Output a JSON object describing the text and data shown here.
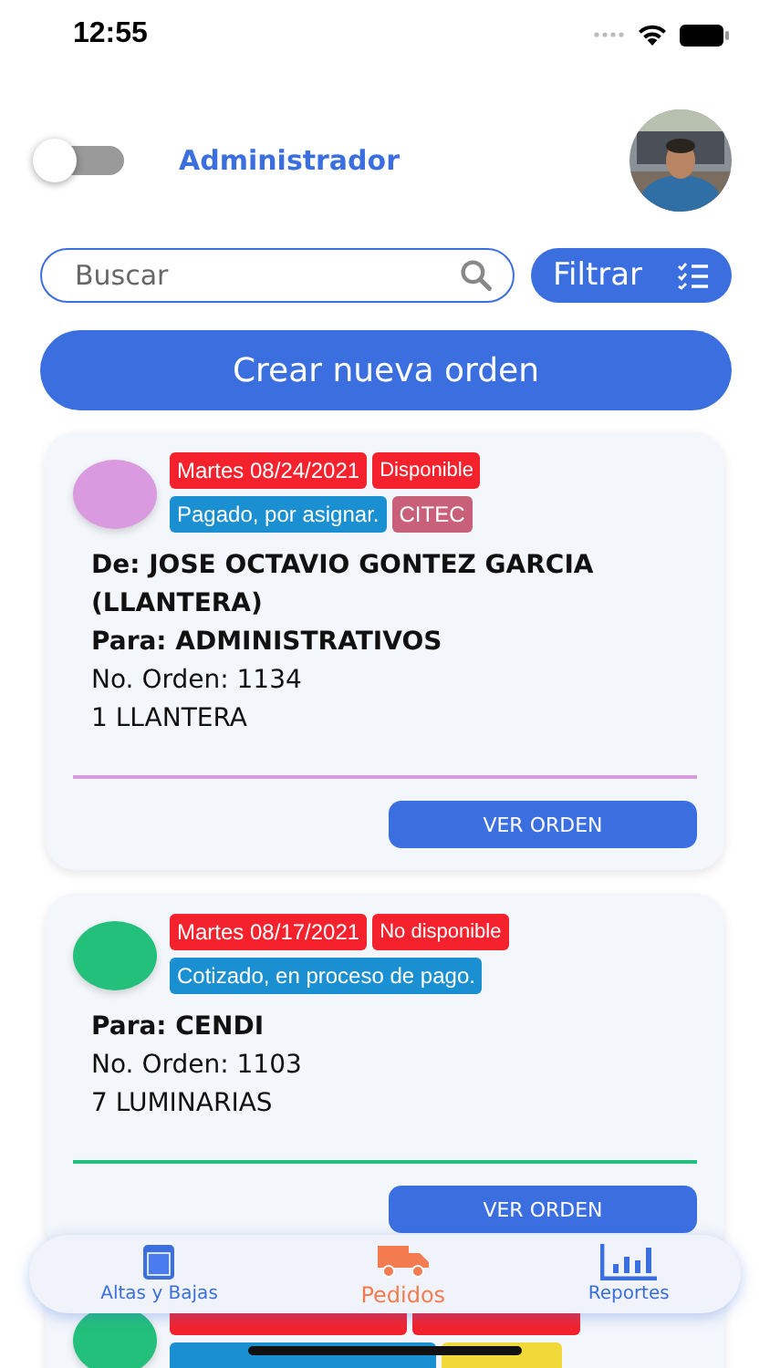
{
  "status_bar": {
    "time": "12:55"
  },
  "header": {
    "toggle": {
      "on": false
    },
    "title": "Administrador"
  },
  "search": {
    "placeholder": "Buscar"
  },
  "filter_button": {
    "label": "Filtrar"
  },
  "create_button": {
    "label": "Crear nueva orden"
  },
  "orders": [
    {
      "color": "#d99ae0",
      "tags": [
        {
          "text": "Martes 08/24/2021",
          "color": "#f5222d"
        },
        {
          "text": "Disponible",
          "color": "#f5222d"
        },
        {
          "text": "Pagado, por asignar.",
          "color": "#1a8fd1"
        },
        {
          "text": "CITEC",
          "color": "#c9607a"
        }
      ],
      "lines": [
        {
          "kind": "bold",
          "text": "De: JOSE OCTAVIO GONTEZ GARCIA (LLANTERA)"
        },
        {
          "kind": "bold",
          "text": "Para: ADMINISTRATIVOS"
        },
        {
          "kind": "plain",
          "text": "No. Orden: 1134"
        },
        {
          "kind": "plain",
          "text": "1 LLANTERA"
        }
      ],
      "button": "VER ORDEN"
    },
    {
      "color": "#22c07a",
      "tags": [
        {
          "text": "Martes 08/17/2021",
          "color": "#f5222d"
        },
        {
          "text": "No disponible",
          "color": "#f5222d"
        },
        {
          "text": "Cotizado, en proceso de pago.",
          "color": "#1a8fd1"
        }
      ],
      "lines": [
        {
          "kind": "bold",
          "text": "Para: CENDI"
        },
        {
          "kind": "plain",
          "text": "No. Orden: 1103"
        },
        {
          "kind": "plain",
          "text": "7 LUMINARIAS"
        }
      ],
      "button": "VER ORDEN"
    },
    {
      "color": "#22c07a",
      "tags": [
        {
          "color": "#f5222d"
        },
        {
          "color": "#f5222d"
        },
        {
          "color": "#1a8fd1"
        },
        {
          "color": "#f2d93a"
        }
      ]
    }
  ],
  "bottom_nav": [
    {
      "label": "Altas y Bajas",
      "selected": false
    },
    {
      "label": "Pedidos",
      "selected": true
    },
    {
      "label": "Reportes",
      "selected": false
    }
  ]
}
